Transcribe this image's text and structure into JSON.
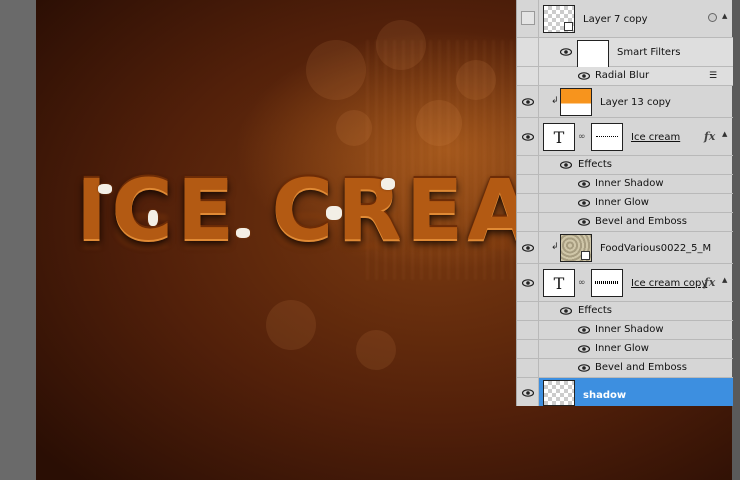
{
  "canvas": {
    "text": "ICE CREA",
    "background_color": "#52200a",
    "text_color": "#b35a13"
  },
  "layers": [
    {
      "name": "Layer 7 copy",
      "visible": false,
      "thumb": "checker-smart-object",
      "right_icon": "smart-filter-icon"
    },
    {
      "name": "Smart Filters",
      "visible": true,
      "thumb": "white-mask",
      "indent": true
    },
    {
      "name": "Radial Blur",
      "visible": true,
      "indent": true,
      "right_icon": "filter-options-icon"
    },
    {
      "name": "Layer 13 copy",
      "visible": true,
      "thumb": "orange-fill",
      "clipped": true
    },
    {
      "name": "Ice cream",
      "visible": true,
      "thumb": "text-layer",
      "fx": "fx"
    },
    {
      "name": "Effects",
      "visible": true,
      "indent": true
    },
    {
      "name": "Inner Shadow",
      "visible": true,
      "indent": true
    },
    {
      "name": "Inner Glow",
      "visible": true,
      "indent": true
    },
    {
      "name": "Bevel and Emboss",
      "visible": true,
      "indent": true
    },
    {
      "name": "FoodVarious0022_5_M",
      "visible": true,
      "thumb": "texture",
      "clipped": true
    },
    {
      "name": "Ice cream copy",
      "visible": true,
      "thumb": "text-layer",
      "fx": "fx"
    },
    {
      "name": "Effects",
      "visible": true,
      "indent": true
    },
    {
      "name": "Inner Shadow",
      "visible": true,
      "indent": true
    },
    {
      "name": "Inner Glow",
      "visible": true,
      "indent": true
    },
    {
      "name": "Bevel and Emboss",
      "visible": true,
      "indent": true
    },
    {
      "name": "shadow",
      "visible": true,
      "thumb": "checker",
      "selected": true
    }
  ],
  "selection_color": "#3d8fe0",
  "orange_color": "#f7941d",
  "text_thumb_glyph": "T"
}
